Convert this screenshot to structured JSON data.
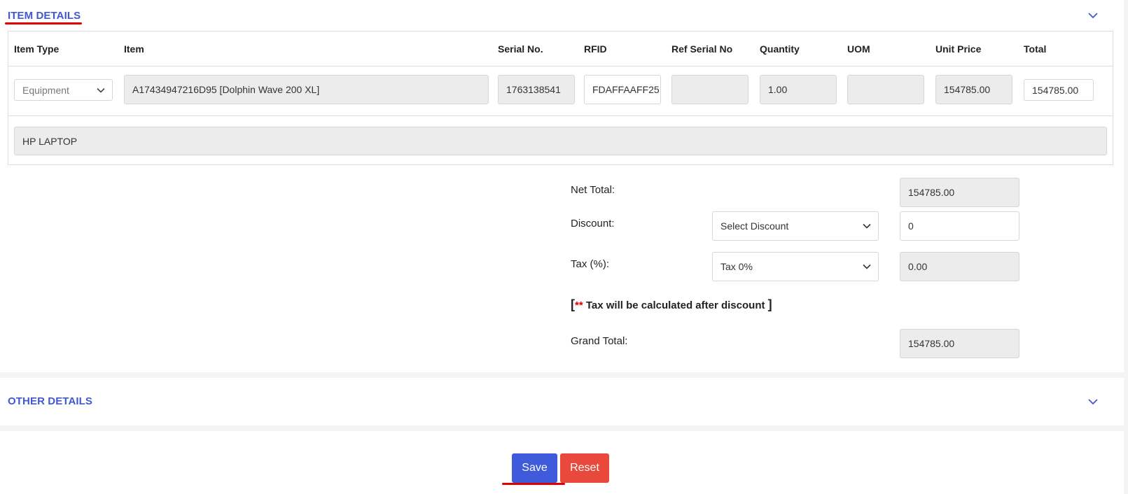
{
  "item_details": {
    "title": "ITEM DETAILS",
    "columns": [
      "Item Type",
      "Item",
      "Serial No.",
      "RFID",
      "Ref Serial No",
      "Quantity",
      "UOM",
      "Unit Price",
      "Total"
    ],
    "row": {
      "item_type": "Equipment",
      "item": "A17434947216D95 [Dolphin Wave 200 XL]",
      "serial_no": "1763138541",
      "rfid": "FDAFFAAFF25",
      "ref_serial_no": "",
      "quantity": "1.00",
      "uom": "",
      "unit_price": "154785.00",
      "total": "154785.00"
    },
    "description": "HP LAPTOP"
  },
  "summary": {
    "net_total_label": "Net Total:",
    "net_total_value": "154785.00",
    "discount_label": "Discount:",
    "discount_select": "Select Discount",
    "discount_value": "0",
    "tax_label": "Tax (%):",
    "tax_select": "Tax 0%",
    "tax_value": "0.00",
    "note_open": "[",
    "note_stars": "**",
    "note_text": " Tax will be calculated after discount ",
    "note_close": "]",
    "grand_total_label": "Grand Total:",
    "grand_total_value": "154785.00"
  },
  "other_details": {
    "title": "OTHER DETAILS"
  },
  "actions": {
    "save": "Save",
    "reset": "Reset"
  },
  "colors": {
    "accent": "#4158d0",
    "save": "#3f5bdb",
    "reset": "#e8493b",
    "highlight": "#e00000"
  },
  "icons": {
    "section_toggle": "chevron-down-icon",
    "select_caret": "caret-down-icon"
  }
}
